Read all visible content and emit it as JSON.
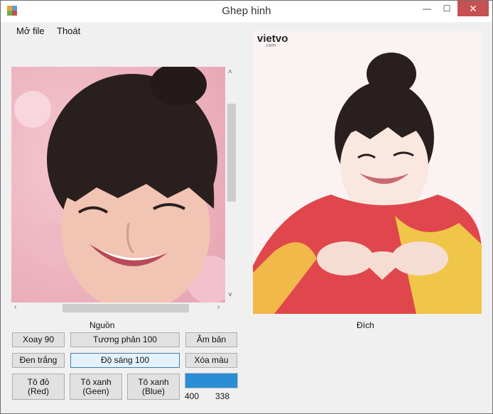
{
  "window": {
    "title": "Ghep hinh",
    "minimize": "—",
    "maximize": "☐",
    "close": "✕"
  },
  "menu": {
    "open_file": "Mở file",
    "exit": "Thoát"
  },
  "source": {
    "caption": "Nguồn"
  },
  "destination": {
    "caption": "Đích",
    "watermark": "vietvo",
    "watermark_sub": ".com"
  },
  "buttons": {
    "rotate": "Xoay 90",
    "contrast": "Tương phản 100",
    "negative": "Âm bản",
    "grayscale": "Đen trắng",
    "brightness": "Độ sáng 100",
    "clear_color": "Xóa màu",
    "red_line1": "Tô đỏ",
    "red_line2": "(Red)",
    "green_line1": "Tô xanh",
    "green_line2": "(Geen)",
    "blue_line1": "Tô xanh",
    "blue_line2": "(Blue)"
  },
  "progress": {
    "value": 1.0,
    "color": "#2a8ed6"
  },
  "dimensions": {
    "width": "400",
    "height": "338"
  }
}
